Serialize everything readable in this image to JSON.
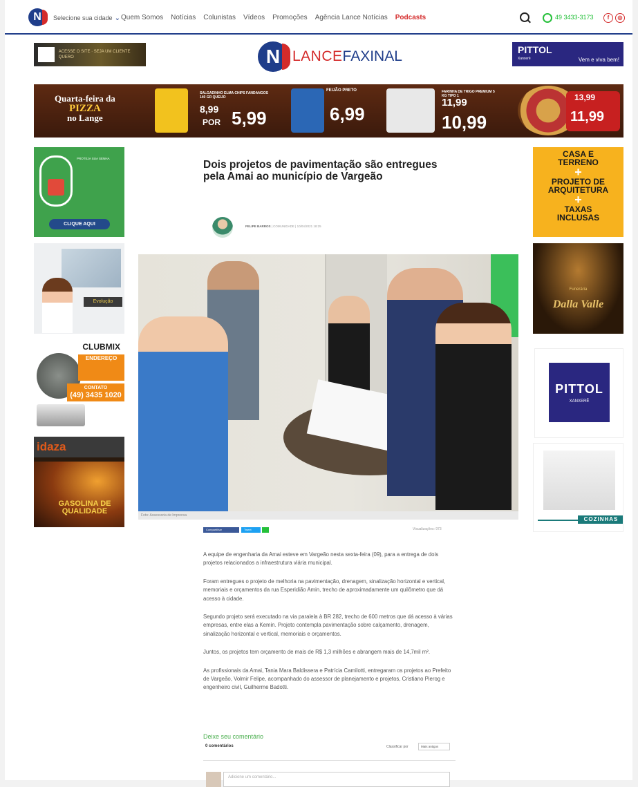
{
  "nav": {
    "city_label": "Selecione sua cidade",
    "items": [
      "Quem Somos",
      "Notícias",
      "Colunistas",
      "Vídeos",
      "Promoções",
      "Agência Lance Notícias"
    ],
    "podcasts": "Podcasts",
    "phone": "49 3433-3173",
    "social": [
      "f",
      "◎"
    ]
  },
  "header": {
    "brand_part1": "LANCE",
    "brand_part2": "FAXINAL",
    "ad_left_text": "ACESSE O SITE · SEJA UM CLIENTE QUERO",
    "pittol_name": "PITTOL",
    "pittol_city": "Xanxerê",
    "pittol_slogan": "Vem e viva bem!"
  },
  "banner": {
    "title_line1": "Quarta-feira da",
    "title_line2": "PIZZA",
    "title_line3": "no Lange",
    "p1_desc": "SALGADINHO ELMA CHIPS FANDANGOS 140 GR QUEIJO",
    "p1_price_a": "8,99",
    "p1_por": "POR",
    "p1_price_b": "5,99",
    "p2_desc": "FEIJÃO PRETO",
    "p2_price": "6,99",
    "p3_desc": "FARINHA DE TRIGO PREMIUM 5 KG TIPO 1",
    "p3_price_a": "11,99",
    "p3_price_b": "10,99",
    "p4_price_a": "13,99",
    "p4_price_b": "11,99"
  },
  "ads": {
    "senha_text": "PROTEJA SUA SENHA",
    "senha_button": "CLIQUE AQUI",
    "evo_logo": "Evolução",
    "club_logo": "CLUBMIX",
    "club_addr_title": "ENDEREÇO",
    "club_contact_title": "CONTATO",
    "club_phone": "(49) 3435 1020",
    "idaza_logo": "idaza",
    "idaza_slogan": "GASOLINA DE QUALIDADE",
    "casa_line1": "CASA E",
    "casa_line2": "TERRENO",
    "casa_line3": "PROJETO DE",
    "casa_line4": "ARQUITETURA",
    "casa_line5": "TAXAS",
    "casa_line6": "INCLUSAS",
    "dalla_title": "Dalla Valle",
    "dalla_sub": "Funerária",
    "pittol_side_name": "PITTOL",
    "pittol_side_city": "XANXERÊ",
    "cozinhas_label": "COZINHAS"
  },
  "article": {
    "headline": "Dois projetos de pavimentação são entregues pela Amai ao município de Vargeão",
    "author": "FELIPE BARROS",
    "byline_rest": " | COMUNIDADE | 10/04/2021 18:25",
    "caption": "Foto: Assessoria de Imprensa",
    "share_fb": "Compartilhar",
    "share_tw": "Tweet",
    "views": "Visualizações: 973",
    "paragraphs": [
      "A equipe de engenharia da Amai esteve em Vargeão nesta sexta-feira (09), para a entrega de dois projetos relacionados a infraestrutura viária municipal.",
      "Foram entregues o projeto de melhoria na pavimentação, drenagem, sinalização horizontal e vertical, memoriais e orçamentos da rua Esperidião Amin, trecho de aproximadamente um quilômetro que dá acesso à cidade.",
      "Segundo projeto será executado na via paralela à BR 282, trecho de 600 metros que dá acesso à várias empresas, entre elas a Kemin. Projeto contempla pavimentação sobre calçamento, drenagem, sinalização horizontal e vertical, memoriais e orçamentos.",
      "Juntos, os projetos tem orçamento de mais de R$ 1,3 milhões e abrangem mais de 14,7mil m².",
      "As profissionais da Amai, Tania Mara Baldissera e Patrícia Camilotti, entregaram os projetos ao Prefeito de Vargeão, Volmir Felipe, acompanhado do assessor de planejamento e projetos, Cristiano Pierog e engenheiro civil, Guilherme Badotti."
    ]
  },
  "comments": {
    "title": "Deixe seu comentário",
    "count": "0 comentários",
    "sort_label": "Classificar por",
    "sort_value": "Mais antigos",
    "placeholder": "Adicione um comentário..."
  },
  "colors": {
    "brand_blue": "#1f3d8a",
    "brand_red": "#d42b2b",
    "green": "#4caf50"
  }
}
